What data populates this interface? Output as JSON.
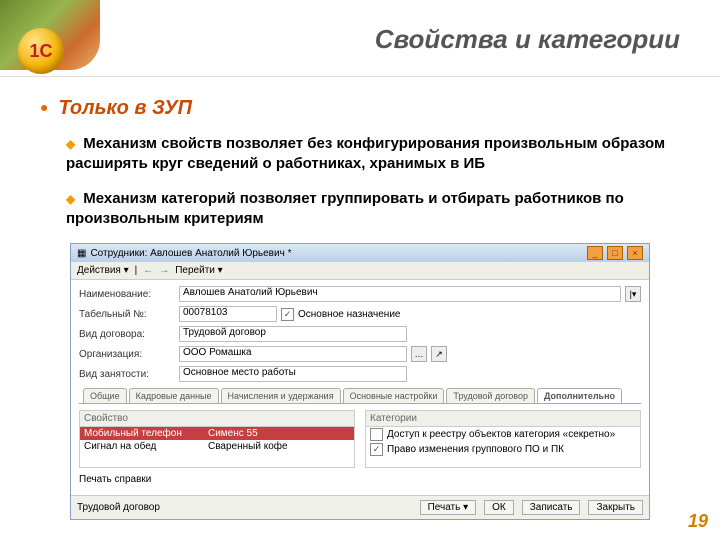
{
  "slide": {
    "title": "Свойства и категории",
    "section": "Только в ЗУП",
    "bullets": [
      "Механизм свойств позволяет без конфигурирования произвольным образом расширять круг сведений о работниках, хранимых в ИБ",
      "Механизм категорий позволяет группировать и отбирать работников по произвольным критериям"
    ],
    "page_number": "19"
  },
  "app": {
    "logo_text": "1С",
    "window_title": "Сотрудники: Авлошев Анатолий Юрьевич *",
    "toolbar_actions": "Действия ▾",
    "toolbar_go": "Перейти ▾",
    "fields": {
      "name_label": "Наименование:",
      "name_value": "Авлошев Анатолий Юрьевич",
      "tabno_label": "Табельный №:",
      "tabno_value": "00078103",
      "chk_general": "Основное назначение",
      "contract_label": "Вид договора:",
      "contract_value": "Трудовой договор",
      "org_label": "Организация:",
      "org_value": "ООО Ромашка",
      "emp_label": "Вид занятости:",
      "emp_value": "Основное место работы"
    },
    "tabs": {
      "t1": "Общие",
      "t2": "Кадровые данные",
      "t3": "Начисления и удержания",
      "t4": "Основные настройки",
      "t5": "Трудовой договор",
      "active": "Дополнительно"
    },
    "props_col_head": "Свойство",
    "cats_col_head": "Категории",
    "props": {
      "r1_label": "Мобильный телефон",
      "r1_value": "Сименс 55",
      "r2_label": "Сигнал на обед",
      "r2_value": "Сваренный кофе"
    },
    "cats": {
      "c1": "Доступ к реестру объектов категория «секретно»",
      "c2": "Право изменения группового ПО и ПК"
    },
    "footer": {
      "print_label": "Печать справки",
      "contract_label": "Трудовой договор",
      "print_btn": "Печать ▾",
      "ok": "ОК",
      "save": "Записать",
      "close": "Закрыть"
    }
  }
}
